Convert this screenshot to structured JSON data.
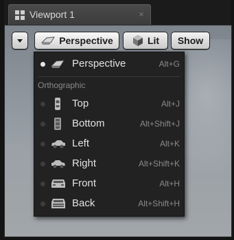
{
  "tab": {
    "title": "Viewport 1",
    "close": "×"
  },
  "toolbar": {
    "perspective_label": "Perspective",
    "lit_label": "Lit",
    "show_label": "Show"
  },
  "menu": {
    "section_label": "Orthographic",
    "items": [
      {
        "label": "Perspective",
        "shortcut": "Alt+G",
        "icon": "perspective-icon",
        "selected": true
      },
      {
        "label": "Top",
        "shortcut": "Alt+J",
        "icon": "top-view-icon",
        "selected": false
      },
      {
        "label": "Bottom",
        "shortcut": "Alt+Shift+J",
        "icon": "bottom-view-icon",
        "selected": false
      },
      {
        "label": "Left",
        "shortcut": "Alt+K",
        "icon": "left-view-icon",
        "selected": false
      },
      {
        "label": "Right",
        "shortcut": "Alt+Shift+K",
        "icon": "right-view-icon",
        "selected": false
      },
      {
        "label": "Front",
        "shortcut": "Alt+H",
        "icon": "front-view-icon",
        "selected": false
      },
      {
        "label": "Back",
        "shortcut": "Alt+Shift+H",
        "icon": "back-view-icon",
        "selected": false
      }
    ]
  }
}
